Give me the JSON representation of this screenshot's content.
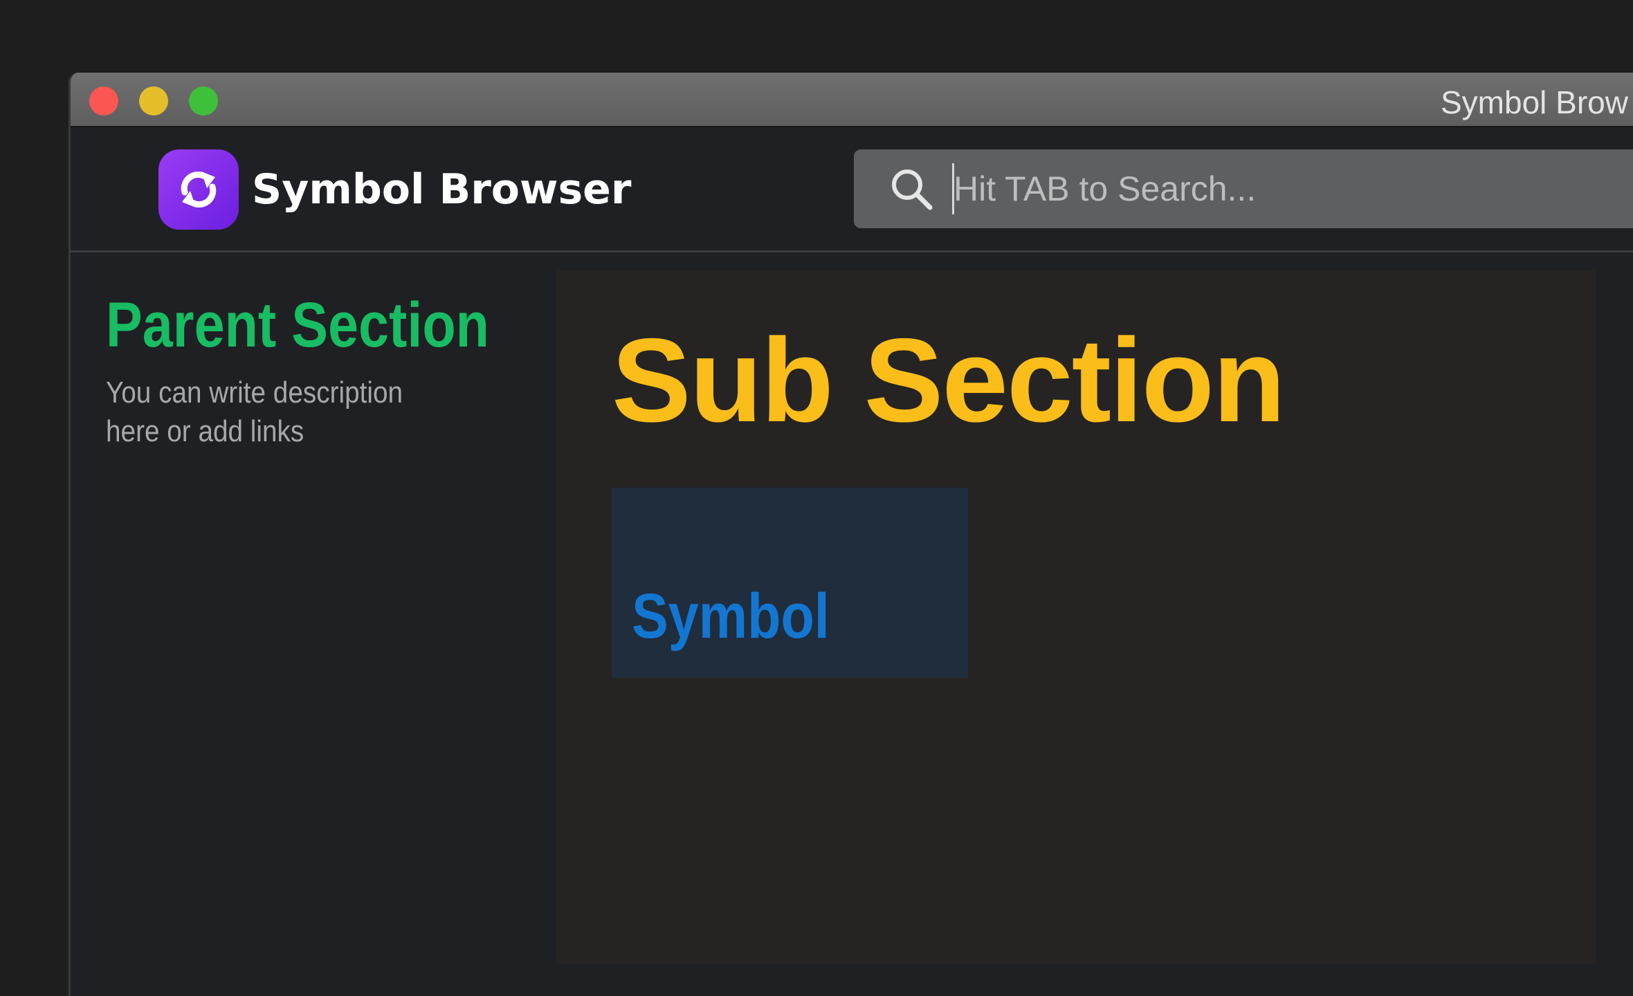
{
  "window": {
    "title": "Symbol Brow"
  },
  "header": {
    "brand": "Symbol Browser",
    "logo_icon": "refresh-arrows-icon"
  },
  "search": {
    "placeholder": "Hit TAB to Search...",
    "value": ""
  },
  "sidebar": {
    "title": "Parent Section",
    "description": "You can write description here or add links"
  },
  "main": {
    "title": "Sub Section",
    "cards": [
      {
        "label": "Symbol"
      }
    ]
  },
  "colors": {
    "parent_title": "#17bc63",
    "sub_title": "#fbbd19",
    "symbol_label": "#1376d1",
    "logo": "#8a2ff0"
  }
}
